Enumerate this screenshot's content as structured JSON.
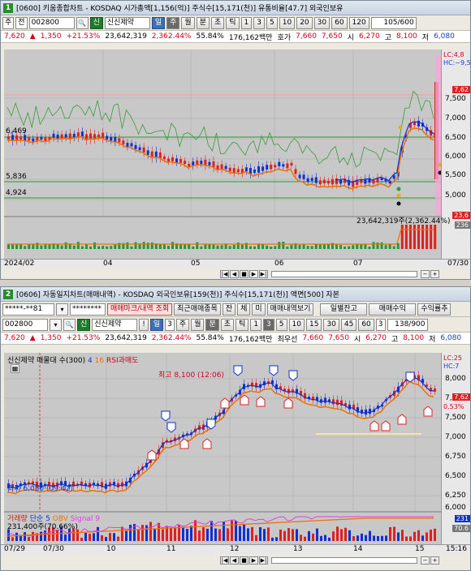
{
  "w1": {
    "title_num": "1",
    "title": "[0600] 키움종합차트 - KOSDAQ 시가총액[1,156(억)] 주식수[15,171(천)] 유통비율[47.7] 외국인보유",
    "toolbar": {
      "type": "주",
      "mode": "전",
      "code": "002800",
      "name_badge": "신",
      "name": "신신제약",
      "period_tabs": [
        "일",
        "주",
        "월",
        "분",
        "초",
        "틱"
      ],
      "nums": [
        "1",
        "3",
        "5",
        "10",
        "20",
        "30",
        "60",
        "120"
      ],
      "count": "105/600"
    },
    "info": {
      "price": "7,620",
      "change": "1,350",
      "pct": "+21.53%",
      "vol": "23,642,319",
      "vol_pct": "2,362.44%",
      "ratio": "55.84%",
      "amount": "176,162백만",
      "hoga_label": "호가",
      "ask": "7,660",
      "bid": "7,650",
      "open_label": "시",
      "open": "6,270",
      "high_label": "고",
      "high": "8,100",
      "low_label": "저",
      "low": "6,080"
    },
    "price_labels": [
      "6,469",
      "5,836",
      "4,924"
    ],
    "yaxis": [
      "6,500",
      "6,000",
      "5,500",
      "5,000",
      "7,000",
      "7,500"
    ],
    "yaxis_top": [
      "LC:4,8",
      "HC:~9,5"
    ],
    "price_tag": "7,62",
    "vol_label": "23,642,319주(2,362.44%)",
    "vol_tag": "23,6",
    "vol_tag2": "236",
    "xaxis": [
      "2024/02",
      "04",
      "05",
      "06",
      "07",
      "07/30"
    ]
  },
  "w2": {
    "title_num": "2",
    "title": "[0606] 자동일지차트(매매내역) - KOSDAQ 외국인보유[159(천)] 주식수[15,171(천)] 액면[500] 자본",
    "row1": {
      "account": "*****-**81",
      "pw": "********",
      "btn1": "매매마크/내역 조회",
      "btn2": "최근매매종목",
      "b_jan": "잔",
      "b_che": "체",
      "b_mi": "미",
      "btn3": "매매내역보기",
      "btn4": "일별잔고",
      "btn5": "매매수익",
      "btn6": "수익률추"
    },
    "row2": {
      "code": "002800",
      "name_badge": "신",
      "name": "신신제약",
      "excl": "!",
      "day": "일",
      "day_n": "3",
      "period_tabs": [
        "주",
        "월",
        "분",
        "초",
        "틱"
      ],
      "nums": [
        "1",
        "3",
        "5",
        "10",
        "15",
        "30",
        "45",
        "60"
      ],
      "sel": "3",
      "count": "138/900"
    },
    "info": {
      "price": "7,620",
      "change": "1,350",
      "pct": "+21.53%",
      "vol": "23,642,319",
      "vol_pct": "2,362.44%",
      "ratio": "55.84%",
      "amount": "176,162백만",
      "label": "최우선",
      "ask": "7,660",
      "bid": "7,650",
      "open_label": "시",
      "open": "6,270",
      "high_label": "고",
      "high": "8,100",
      "low_label": "저",
      "low": "6,080"
    },
    "legend": {
      "name": "신신제약 매물대 수(300)",
      "ma1": "4",
      "ma2": "16",
      "ind": "RSI과매도"
    },
    "high_label": "최고 8,100 (12:06)",
    "low_label": "최저 6,080 (09:42)",
    "yaxis": [
      "8,000",
      "7,750",
      "7,500",
      "7,250",
      "7,000",
      "6,750",
      "6,500",
      "6,250",
      "6,000"
    ],
    "yaxis_top": [
      "LC:25",
      "HC:7"
    ],
    "price_tag": "7,62",
    "price_tag2": "0.53%",
    "vol_legend": {
      "a": "거래량",
      "b": "단순 5",
      "c": "OBV",
      "d": "Signal 9"
    },
    "vol_label": "231,400주(70.66%)",
    "vol_tags": [
      "231",
      "70.6"
    ],
    "xaxis": [
      "07/29",
      "07/30",
      "10",
      "11",
      "12",
      "13",
      "14",
      "15",
      "15:16"
    ]
  }
}
